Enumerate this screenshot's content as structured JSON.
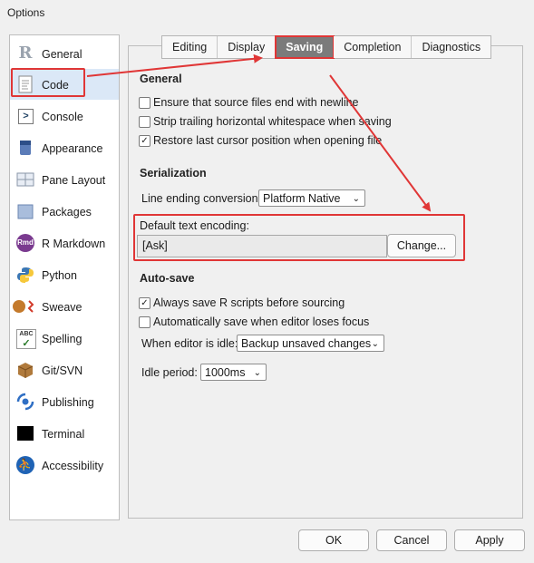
{
  "window": {
    "title": "Options"
  },
  "sidebar": {
    "items": [
      {
        "label": "General",
        "icon": "r-logo-icon"
      },
      {
        "label": "Code",
        "icon": "code-document-icon"
      },
      {
        "label": "Console",
        "icon": "console-prompt-icon"
      },
      {
        "label": "Appearance",
        "icon": "paint-bucket-icon"
      },
      {
        "label": "Pane Layout",
        "icon": "pane-layout-icon"
      },
      {
        "label": "Packages",
        "icon": "package-box-icon"
      },
      {
        "label": "R Markdown",
        "icon": "rmd-icon"
      },
      {
        "label": "Python",
        "icon": "python-logo-icon"
      },
      {
        "label": "Sweave",
        "icon": "sweave-pdf-icon"
      },
      {
        "label": "Spelling",
        "icon": "spelling-abc-icon"
      },
      {
        "label": "Git/SVN",
        "icon": "git-box-icon"
      },
      {
        "label": "Publishing",
        "icon": "publishing-icon"
      },
      {
        "label": "Terminal",
        "icon": "terminal-icon"
      },
      {
        "label": "Accessibility",
        "icon": "accessibility-icon"
      }
    ],
    "selected": "Code"
  },
  "tabs": [
    "Editing",
    "Display",
    "Saving",
    "Completion",
    "Diagnostics"
  ],
  "active_tab": "Saving",
  "general": {
    "title": "General",
    "ensure_newline": {
      "label": "Ensure that source files end with newline",
      "checked": false
    },
    "strip_whitespace": {
      "label": "Strip trailing horizontal whitespace when saving",
      "checked": false
    },
    "restore_cursor": {
      "label": "Restore last cursor position when opening file",
      "checked": true
    }
  },
  "serialization": {
    "title": "Serialization",
    "line_ending_label": "Line ending conversion:",
    "line_ending_value": "Platform Native",
    "encoding_label": "Default text encoding:",
    "encoding_value": "[Ask]",
    "change_button": "Change..."
  },
  "autosave": {
    "title": "Auto-save",
    "always_save": {
      "label": "Always save R scripts before sourcing",
      "checked": true
    },
    "auto_save_focus": {
      "label": "Automatically save when editor loses focus",
      "checked": false
    },
    "idle_label": "When editor is idle:",
    "idle_value": "Backup unsaved changes",
    "period_label": "Idle period:",
    "period_value": "1000ms"
  },
  "footer": {
    "ok": "OK",
    "cancel": "Cancel",
    "apply": "Apply"
  },
  "colors": {
    "annotation_red": "#e03636",
    "active_tab_bg": "#7b7b7b",
    "selection_bg": "#dbe8f7"
  },
  "check_glyph": "✓",
  "dropdown_glyph": "⌄"
}
